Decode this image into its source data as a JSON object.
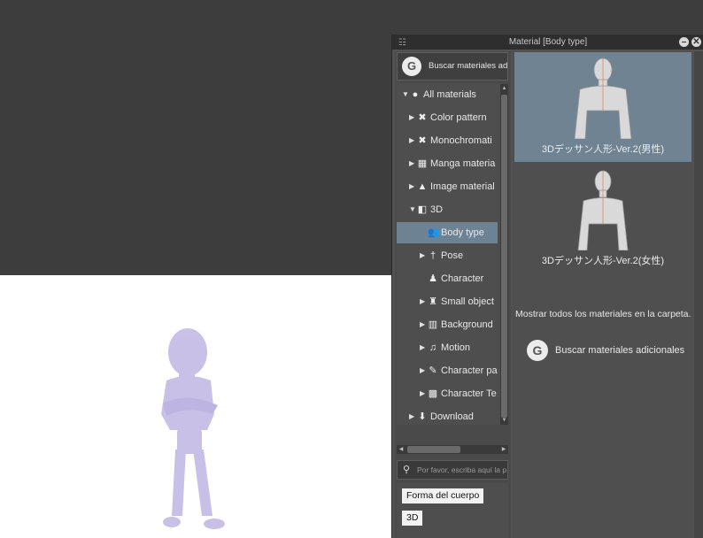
{
  "panel": {
    "title": "Material [Body type]",
    "grip_icon": "☷",
    "minimize_icon": "–",
    "close_icon": "✕"
  },
  "search_more": {
    "label": "Buscar materiales adicio",
    "logo": "G"
  },
  "tree": {
    "items": [
      {
        "label": "All materials",
        "icon": "●",
        "expander": "▼",
        "level": 0
      },
      {
        "label": "Color pattern",
        "icon": "✖",
        "expander": "▶",
        "level": 1
      },
      {
        "label": "Monochromati",
        "icon": "✖",
        "expander": "▶",
        "level": 1
      },
      {
        "label": "Manga materia",
        "icon": "▦",
        "expander": "▶",
        "level": 1
      },
      {
        "label": "Image material",
        "icon": "▲",
        "expander": "▶",
        "level": 1
      },
      {
        "label": "3D",
        "icon": "◧",
        "expander": "▼",
        "level": 1
      },
      {
        "label": "Body type",
        "icon": "👥",
        "expander": "",
        "level": 2,
        "selected": true
      },
      {
        "label": "Pose",
        "icon": "†",
        "expander": "▶",
        "level": 2
      },
      {
        "label": "Character",
        "icon": "♟",
        "expander": "",
        "level": 2
      },
      {
        "label": "Small object",
        "icon": "♜",
        "expander": "▶",
        "level": 2
      },
      {
        "label": "Background",
        "icon": "▥",
        "expander": "▶",
        "level": 2
      },
      {
        "label": "Motion",
        "icon": "♫",
        "expander": "▶",
        "level": 2
      },
      {
        "label": "Character pa",
        "icon": "✎",
        "expander": "▶",
        "level": 2
      },
      {
        "label": "Character Te",
        "icon": "▩",
        "expander": "▶",
        "level": 2
      },
      {
        "label": "Download",
        "icon": "⬇",
        "expander": "▶",
        "level": 1
      }
    ]
  },
  "hscroll": {
    "thumb_label": "III"
  },
  "tag_search": {
    "placeholder": "Por favor, escriba aquí la p",
    "icon": "search-icon"
  },
  "tags": [
    "Forma del cuerpo",
    "3D"
  ],
  "materials": [
    {
      "label": "3Dデッサン人形-Ver.2(男性)",
      "selected": true
    },
    {
      "label": "3Dデッサン人形-Ver.2(女性)",
      "selected": false
    }
  ],
  "show_all": "Mostrar todos los materiales en la carpeta.",
  "more_button": {
    "label": "Buscar materiales adicionales",
    "logo": "G"
  },
  "colors": {
    "background": "#3d3d3d",
    "panel": "#525252",
    "selection": "#6d8394",
    "figure": "#b8aee0"
  }
}
